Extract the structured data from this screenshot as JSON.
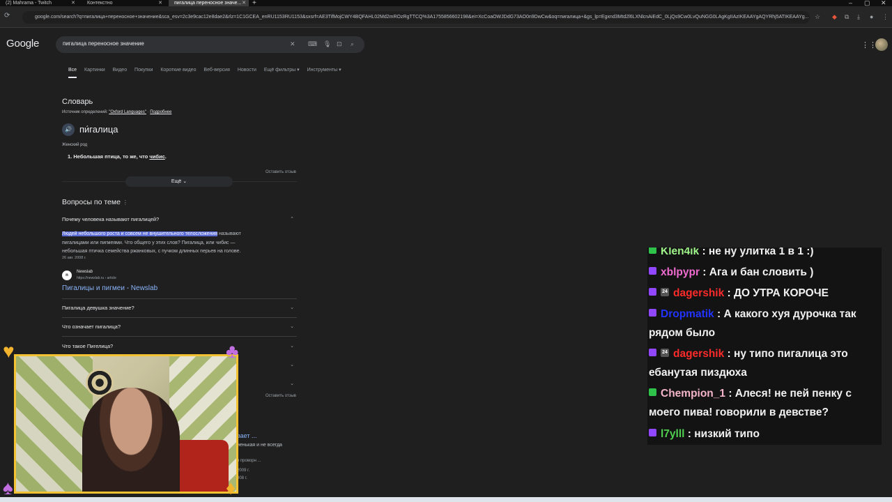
{
  "tabs": [
    {
      "label": "(2) Mahrama - Twitch"
    },
    {
      "label": "Контекстно"
    },
    {
      "label": "пигалица переносное значе..."
    }
  ],
  "address": {
    "url": "google.com/search?q=пигалица+переносное+значение&sca_esv=2c3e9cac12e8dae2&rlz=1C1GCEA_enRU1153RU1153&sxsrf=AE3TifMojCWY4BQFAHL02Md2mROzRgTTCQ%3A1755856602198&ei=XcCoaOWJDdG73AO0n9DwCw&oq=пигалица+&gs_lp=Egxnd3Mtd2l6LXNlcnAiEdC_0LjQs9Cw0LvQuNGG0LAgKgIIAzIKEAAYgAQYRhj5ATIKEAAYg..."
  },
  "google": {
    "logo": "Google",
    "query": "пигалица переносное значение",
    "filters": [
      "Все",
      "Картинки",
      "Видео",
      "Покупки",
      "Короткие видео",
      "Веб-версия",
      "Новости",
      "Ещё фильтры ▾",
      "Инструменты ▾"
    ]
  },
  "dictionary": {
    "title": "Словарь",
    "source_prefix": "Источник определений:",
    "source_link": "\"Oxford Languages\"",
    "more_link": "Подробнее",
    "word": "пи́галица",
    "gender": "Женский род",
    "def_prefix": "1. Небольшая птица, то же, что ",
    "def_link": "чибис",
    "def_suffix": ".",
    "feedback": "Оставить отзыв",
    "more_button": "Ещё"
  },
  "paa": {
    "title": "Вопросы по теме",
    "q1": "Почему человека называют пигалицей?",
    "answer_highlight": "Людей небольшого роста и совсем не внушительного телосложения",
    "answer_rest1": " называют",
    "answer_line2": "пигалицами или пигмеями. Что общего у этих слов? Пигалица, или чибис —",
    "answer_line3": "небольшая птичка семейства ржанковых, с пучком длинных перьев на голове.",
    "answer_date": "26 авг. 2008 г.",
    "source_name": "Newslab",
    "source_url": "https://newslab.ru › article",
    "result_title": "Пигалицы и пигмеи - Newslab",
    "q2": "Пигалица девушка значение?",
    "q3": "Что означает пигалица?",
    "q4": "Что такое Пигелица?",
    "feedback": "Оставить отзыв",
    "partial_link": "вает ...",
    "partial_text": "ненькая и не всегда",
    "partial_text2": "я проворн ...",
    "partial_year1": "2009 г.",
    "partial_year2": "008 г."
  },
  "chat": [
    {
      "user": "Klen4ik",
      "text": "не ну улитка 1 в 1 :)",
      "color": "#9ff58a"
    },
    {
      "user": "xblpypr",
      "text": "Ага и бан словить )",
      "color": "#f06bd0"
    },
    {
      "user": "dagershik",
      "text": "ДО УТРА КОРОЧЕ",
      "color": "#ff2b2b"
    },
    {
      "user": "Dropmatik",
      "text": "А какого хуя дурочка так рядом было",
      "color": "#2233ff"
    },
    {
      "user": "dagershik",
      "text": "ну типо пигалица это ебанутая пиздюха",
      "color": "#ff2b2b"
    },
    {
      "user": "Chempion_1",
      "text": "Алеся! не пей пенку с моего пива! говорили в девстве?",
      "color": "#f3b4c8"
    },
    {
      "user": "l7ylll",
      "text": "низкий типо",
      "color": "#4fd04f"
    }
  ],
  "colors": {
    "page_bg": "#1f1f1f",
    "link": "#8ab4f8",
    "highlight": "#5a6ad4",
    "cam_border": "#f2c232"
  }
}
